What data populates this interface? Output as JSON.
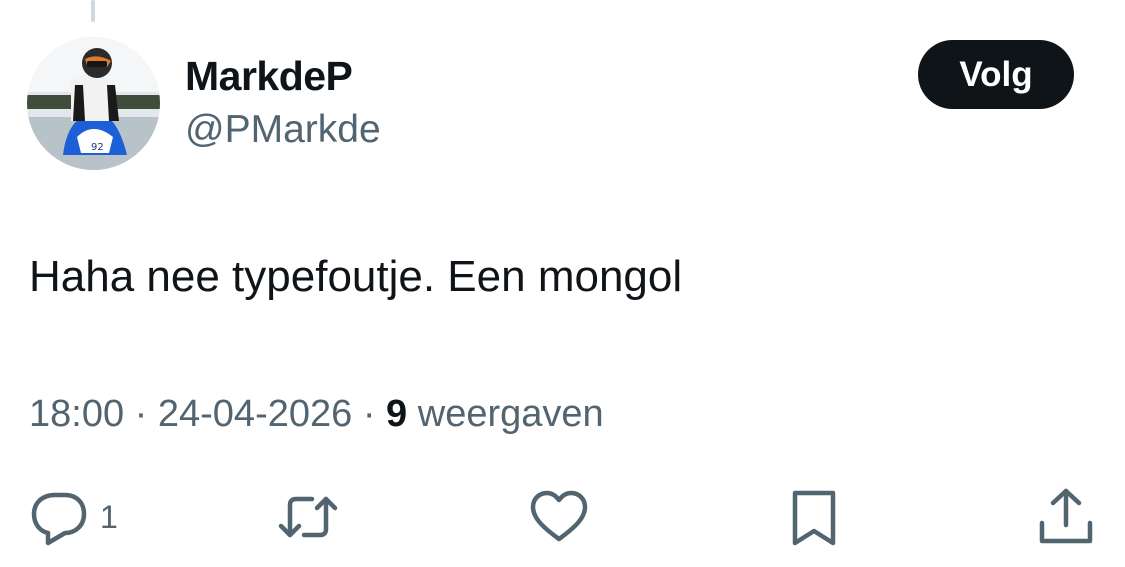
{
  "author": {
    "display_name": "MarkdeP",
    "handle": "@PMarkde",
    "avatar": "avatar-motorcyclist"
  },
  "follow_button": {
    "label": "Volg"
  },
  "tweet": {
    "text_before": "Haha nee typefoutje. Een ",
    "text_highlighted": "mongol",
    "highlight_color": "#fcf77c"
  },
  "meta": {
    "time": "18:00",
    "sep1": "·",
    "date": "24-04-2026",
    "sep2": "·",
    "views_count": "9",
    "views_label": "weergaven"
  },
  "actions": {
    "reply": {
      "icon": "reply-icon",
      "count": "1"
    },
    "retweet": {
      "icon": "retweet-icon"
    },
    "like": {
      "icon": "heart-icon"
    },
    "bookmark": {
      "icon": "bookmark-icon"
    },
    "share": {
      "icon": "share-icon"
    }
  },
  "colors": {
    "text": "#0f1419",
    "secondary": "#536471",
    "button_bg": "#0f1419",
    "button_text": "#ffffff"
  }
}
